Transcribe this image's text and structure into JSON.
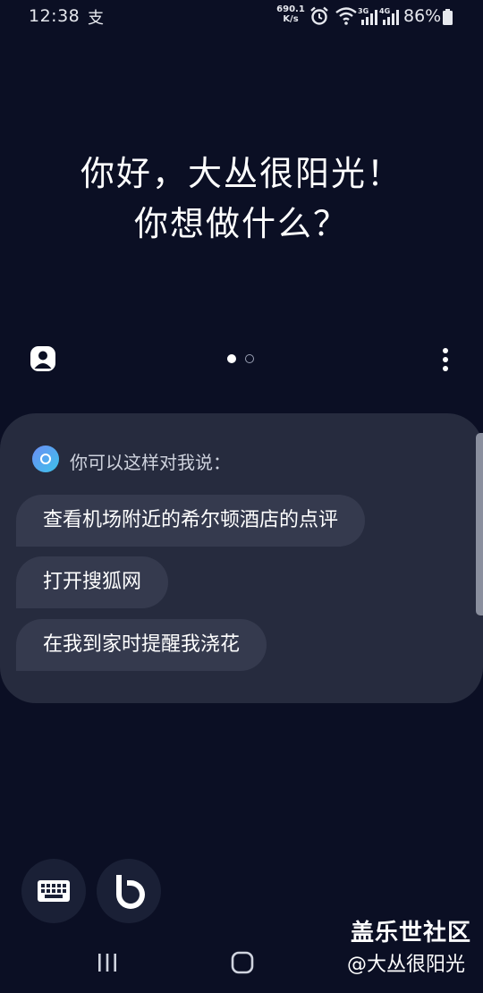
{
  "status_bar": {
    "time": "12:38",
    "notification_glyph": "支",
    "net_speed_value": "690.1",
    "net_speed_unit": "K/s",
    "battery": "86%",
    "icons": [
      "alarm-icon",
      "wifi-icon",
      "signal-3g-icon",
      "signal-4g-icon",
      "battery-icon"
    ]
  },
  "greeting": {
    "line1": "你好，大丛很阳光！",
    "line2": "你想做什么？"
  },
  "pager": {
    "current_page": 1,
    "total_pages": 2
  },
  "card": {
    "title": "你可以这样对我说：",
    "suggestions": [
      "查看机场附近的希尔顿酒店的点评",
      "打开搜狐网",
      "在我到家时提醒我浇花"
    ]
  },
  "watermark": {
    "site": "盖乐世社区",
    "user": "@大丛很阳光"
  },
  "colors": {
    "background": "#0b0f24",
    "card": "#262b3e",
    "chip": "#353a4e",
    "accent": "#4a9ff0"
  }
}
